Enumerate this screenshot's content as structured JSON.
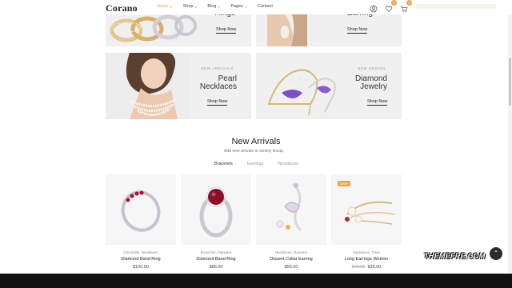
{
  "header": {
    "logo": "Corano",
    "nav": [
      {
        "label": "Home",
        "caret": "∨"
      },
      {
        "label": "Shop",
        "caret": "∨"
      },
      {
        "label": "Blog",
        "caret": "∨"
      },
      {
        "label": "Pages",
        "caret": "∨"
      },
      {
        "label": "Contact",
        "caret": ""
      }
    ],
    "wishlist_count": "0",
    "cart_count": "0"
  },
  "banners": [
    {
      "tag": "",
      "title": "Rings",
      "shop": "Shop Now"
    },
    {
      "tag": "",
      "title": "Earring",
      "shop": "Shop Now"
    },
    {
      "tag": "NEW ARRIVALS",
      "title_l1": "Pearl",
      "title_l2": "Necklaces",
      "shop": "Shop Now"
    },
    {
      "tag": "NEW DESIGN",
      "title_l1": "Diamond",
      "title_l2": "Jewelry",
      "shop": "Shop Now"
    }
  ],
  "section": {
    "title": "New Arrivals",
    "subtitle": "Add new arrivals to weekly lineup",
    "tabs": [
      "Bracelets",
      "Earrings",
      "Necklaces"
    ]
  },
  "products": [
    {
      "cats": "Christalite, Necklaces",
      "name": "Diamond Band Ring",
      "old_price": "",
      "price": "$100.00",
      "sale": ""
    },
    {
      "cats": "Brooches, Flatware",
      "name": "Diamond Band Ring",
      "old_price": "",
      "price": "$86.00",
      "sale": ""
    },
    {
      "cats": "Necklaces, Runners",
      "name": "Dissent Collar Earring",
      "old_price": "",
      "price": "$95.00",
      "sale": ""
    },
    {
      "cats": "Necklaces, Tiara",
      "name": "Long Earrings Women",
      "old_price": "$40.00",
      "price": "$35.00",
      "sale": "Sale!"
    }
  ],
  "watermark": "THEMEFRE.COM",
  "colors": {
    "accent": "#e8a34e",
    "banner_bg": "#f0f0f0",
    "card_bg": "#f6f6f6"
  },
  "icons": [
    "user-icon",
    "heart-icon",
    "cart-icon",
    "arrow-up-icon"
  ]
}
